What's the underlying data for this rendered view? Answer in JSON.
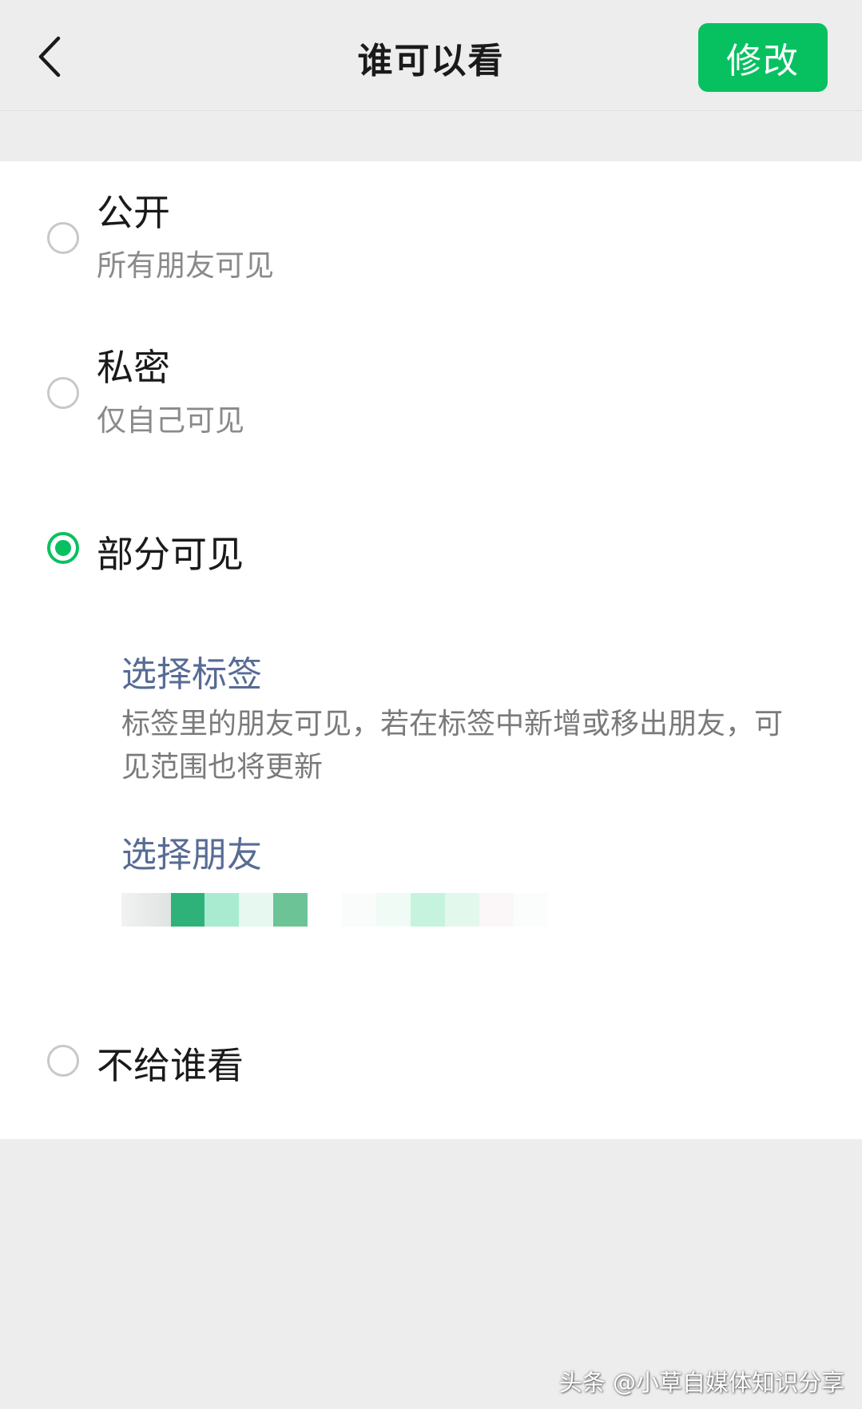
{
  "header": {
    "title": "谁可以看",
    "edit_label": "修改",
    "back_icon": "chevron-left-icon"
  },
  "options": [
    {
      "title": "公开",
      "subtitle": "所有朋友可见",
      "selected": false
    },
    {
      "title": "私密",
      "subtitle": "仅自己可见",
      "selected": false
    },
    {
      "title": "部分可见",
      "selected": true
    },
    {
      "title": "不给谁看",
      "selected": false
    }
  ],
  "partial": {
    "select_tags_label": "选择标签",
    "select_tags_desc": "标签里的朋友可见，若在标签中新增或移出朋友，可见范围也将更新",
    "select_friends_label": "选择朋友"
  },
  "watermark": "头条 @小草自媒体知识分享",
  "colors": {
    "accent_green": "#07c160",
    "link_blue": "#576b95",
    "background": "#ededed",
    "panel": "#ffffff"
  }
}
